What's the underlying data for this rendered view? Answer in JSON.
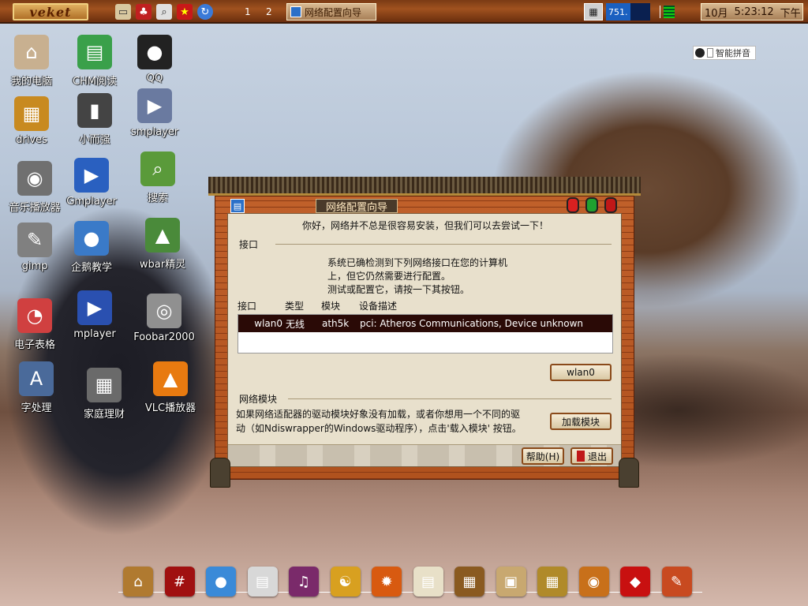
{
  "taskbar": {
    "start_label": "veket",
    "workspace_1": "1",
    "workspace_2": "2",
    "task_window_title": "网络配置向导",
    "net_meter": "751.",
    "clock_month": "10月",
    "clock_time": "5:23:12",
    "clock_period": "下午",
    "icons": [
      "file-manager-icon",
      "network-icon",
      "search-icon",
      "flag-icon",
      "refresh-icon"
    ]
  },
  "desktop_icons": [
    {
      "label": "我的电脑",
      "icon": "computer-icon",
      "color": "#c8b090"
    },
    {
      "label": "CHM阅读",
      "icon": "chm-reader-icon",
      "color": "#3aa04a"
    },
    {
      "label": "QQ",
      "icon": "qq-penguin-icon",
      "color": "#222222"
    },
    {
      "label": "drives",
      "icon": "drives-icon",
      "color": "#c88a20"
    },
    {
      "label": "小而强",
      "icon": "usb-drive-icon",
      "color": "#444444"
    },
    {
      "label": "smplayer",
      "icon": "smplayer-icon",
      "color": "#6a7aa0"
    },
    {
      "label": "音乐播放器",
      "icon": "speaker-icon",
      "color": "#707070"
    },
    {
      "label": "Gmplayer",
      "icon": "gmplayer-icon",
      "color": "#2a60c0"
    },
    {
      "label": "搜索",
      "icon": "search-app-icon",
      "color": "#5a9a3a"
    },
    {
      "label": "gimp",
      "icon": "gimp-icon",
      "color": "#808080"
    },
    {
      "label": "企鹅教学",
      "icon": "penguin-teacher-icon",
      "color": "#3a7ac8"
    },
    {
      "label": "wbar精灵",
      "icon": "wbar-icon",
      "color": "#4a8a3a"
    },
    {
      "label": "电子表格",
      "icon": "spreadsheet-icon",
      "color": "#d04040"
    },
    {
      "label": "mplayer",
      "icon": "mplayer-icon",
      "color": "#2a50b0"
    },
    {
      "label": "Foobar2000",
      "icon": "foobar-icon",
      "color": "#909090"
    },
    {
      "label": "字处理",
      "icon": "word-processor-icon",
      "color": "#4a6a9a"
    },
    {
      "label": "家庭理财",
      "icon": "calculator-icon",
      "color": "#6a6a6a"
    },
    {
      "label": "VLC播放器",
      "icon": "vlc-icon",
      "color": "#e87a10"
    }
  ],
  "ime": {
    "label": "智能拼音"
  },
  "dialog": {
    "title": "网络配置向导",
    "greeting": "你好，网络并不总是很容易安装，但我们可以去尝试一下！",
    "interface_section": "接口",
    "interface_desc_1": "系统已确检测到下列网络接口在您的计算机",
    "interface_desc_2": "上，但它仍然需要进行配置。",
    "interface_desc_3": "测试或配置它，请按一下其按钮。",
    "table_headers": [
      "接口",
      "类型",
      "模块",
      "设备描述"
    ],
    "row": {
      "iface": "wlan0",
      "type": "无线",
      "module": "ath5k",
      "desc": "pci:  Atheros Communications, Device unknown"
    },
    "wlan_button": "wlan0",
    "module_section": "网络模块",
    "module_desc_1": "如果网络适配器的驱动模块好象没有加载，或者你想用一个不同的驱",
    "module_desc_2": "动（如Ndiswrapper的Windows驱动程序），点击'载入模块' 按钮。",
    "load_module_button": "加载模块",
    "help_button": "帮助(H)",
    "exit_button": "退出"
  },
  "dock_icons": [
    {
      "icon": "palace-icon",
      "color": "#b07a30"
    },
    {
      "icon": "notebook-icon",
      "color": "#a01010"
    },
    {
      "icon": "globe-icon",
      "color": "#3a8ad8"
    },
    {
      "icon": "papers-icon",
      "color": "#d8d8d8"
    },
    {
      "icon": "media-disc-icon",
      "color": "#7a2a6a"
    },
    {
      "icon": "yin-yang-icon",
      "color": "#d8a020"
    },
    {
      "icon": "fire-icon",
      "color": "#d85a10"
    },
    {
      "icon": "document-icon",
      "color": "#e8e0c8"
    },
    {
      "icon": "abacus-icon",
      "color": "#8a5a20"
    },
    {
      "icon": "painting-icon",
      "color": "#c8a870"
    },
    {
      "icon": "package-icon",
      "color": "#b08a2a"
    },
    {
      "icon": "bowl-icon",
      "color": "#c8701a"
    },
    {
      "icon": "chinese-knot-icon",
      "color": "#c81010"
    },
    {
      "icon": "ink-icon",
      "color": "#c84a20"
    }
  ]
}
